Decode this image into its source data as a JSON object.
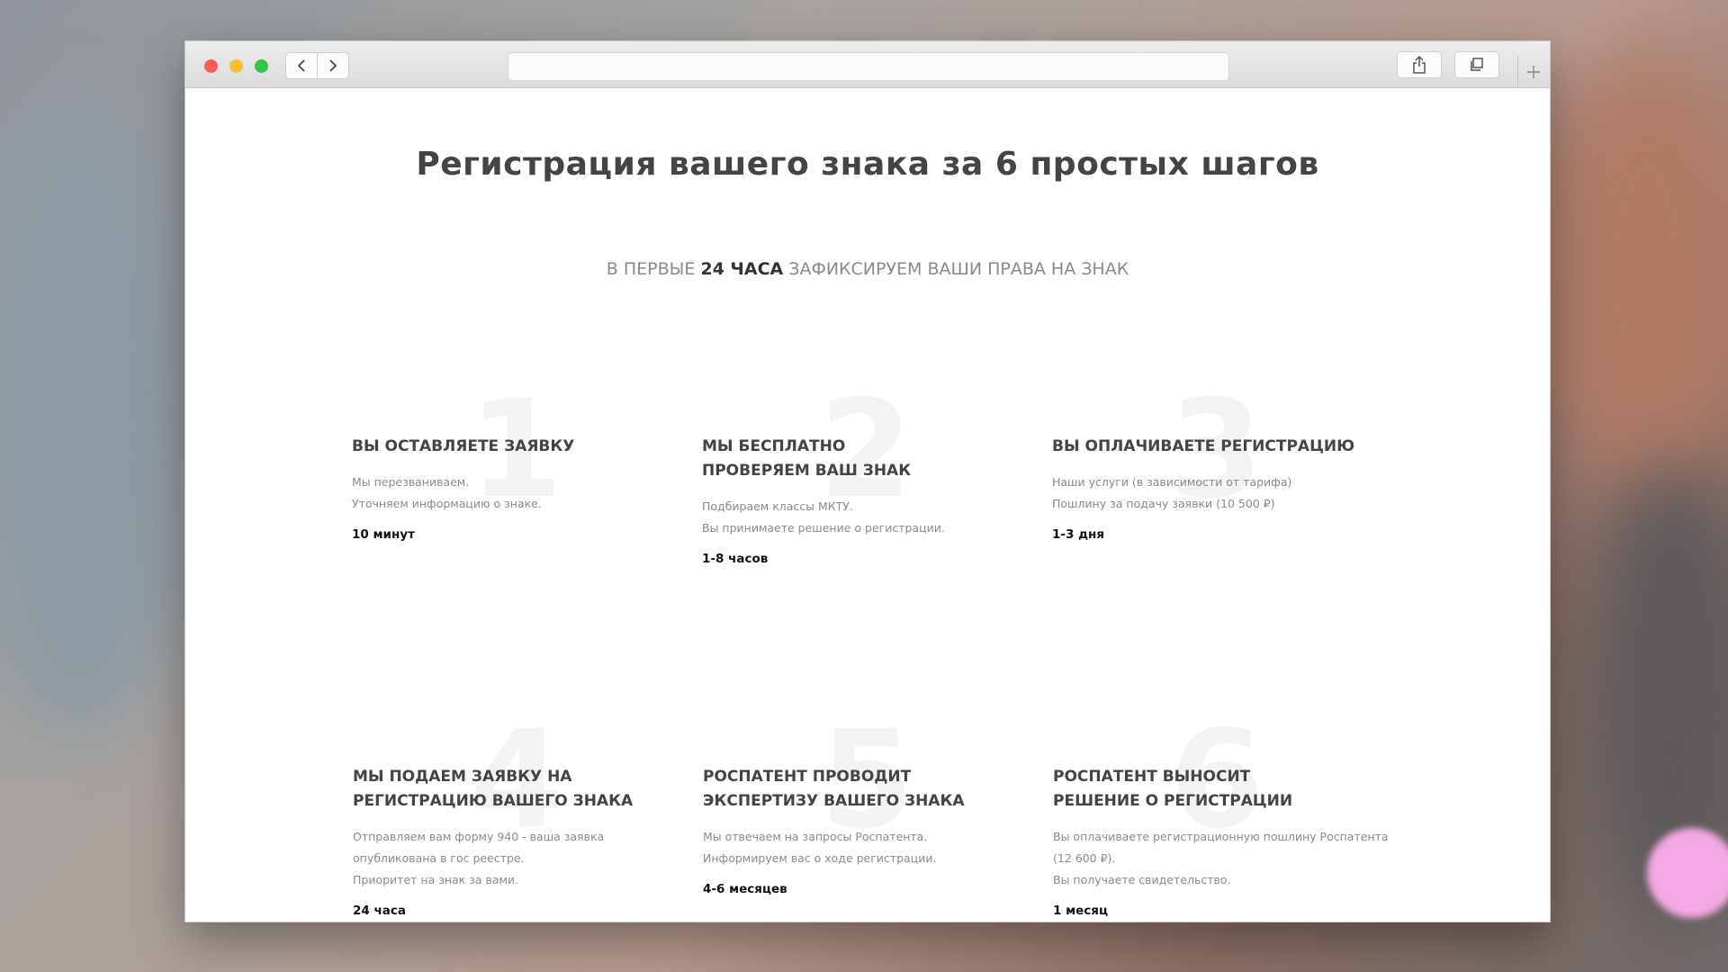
{
  "page": {
    "title": "Регистрация вашего знака за 6 простых шагов",
    "subtitle_pre": "В ПЕРВЫЕ",
    "subtitle_bold": "24 ЧАСА",
    "subtitle_post": "ЗАФИКСИРУЕМ ВАШИ ПРАВА НА ЗНАК"
  },
  "steps": [
    {
      "number": "1",
      "title_line1": "ВЫ ОСТАВЛЯЕТЕ ЗАЯВКУ",
      "title_line2": "",
      "desc_line1": "Мы перезваниваем.",
      "desc_line2": "Уточняем информацию о знаке.",
      "desc_line3": "",
      "time": "10 минут"
    },
    {
      "number": "2",
      "title_line1": "МЫ БЕСПЛАТНО",
      "title_line2": "ПРОВЕРЯЕМ ВАШ ЗНАК",
      "desc_line1": "Подбираем классы МКТУ.",
      "desc_line2": "Вы принимаете решение о регистрации.",
      "desc_line3": "",
      "time": "1-8 часов"
    },
    {
      "number": "3",
      "title_line1": "ВЫ ОПЛАЧИВАЕТЕ РЕГИСТРАЦИЮ",
      "title_line2": "",
      "desc_line1": "Наши услуги (в зависимости от тарифа)",
      "desc_line2": "Пошлину за подачу заявки (10 500 ₽)",
      "desc_line3": "",
      "time": "1-3 дня"
    },
    {
      "number": "4",
      "title_line1": "МЫ ПОДАЕМ ЗАЯВКУ НА",
      "title_line2": "РЕГИСТРАЦИЮ ВАШЕГО ЗНАКА",
      "desc_line1": "Отправляем вам форму 940 - ваша заявка",
      "desc_line2": "опубликована в гос реестре.",
      "desc_line3": "Приоритет на знак за вами.",
      "time": "24 часа"
    },
    {
      "number": "5",
      "title_line1": "РОСПАТЕНТ ПРОВОДИТ",
      "title_line2": "ЭКСПЕРТИЗУ ВАШЕГО ЗНАКА",
      "desc_line1": "Мы отвечаем на запросы Роспатента.",
      "desc_line2": "Информируем вас о ходе регистрации.",
      "desc_line3": "",
      "time": "4-6 месяцев"
    },
    {
      "number": "6",
      "title_line1": "РОСПАТЕНТ ВЫНОСИТ",
      "title_line2": "РЕШЕНИЕ О РЕГИСТРАЦИИ",
      "desc_line1": "Вы оплачиваете регистрационную пошлину Роспатента",
      "desc_line2": "(12 600 ₽).",
      "desc_line3": "Вы получаете свидетельство.",
      "time": "1 месяц"
    }
  ],
  "icons": {
    "back": "chevron-left-icon",
    "forward": "chevron-right-icon",
    "share": "share-icon",
    "tabs": "tabs-overview-icon",
    "new_tab": "plus-icon"
  },
  "colors": {
    "close": "#fc5e57",
    "minimize": "#fdbc2e",
    "zoom": "#33c748",
    "heading": "#444444",
    "muted": "#8a8a8a"
  }
}
